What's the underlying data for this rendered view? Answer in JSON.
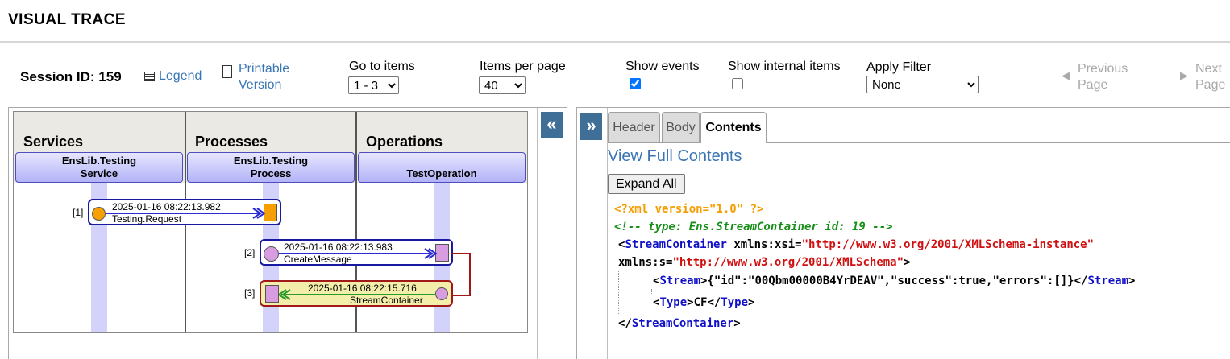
{
  "header": {
    "title": "VISUAL TRACE"
  },
  "toolbar": {
    "session_label": "Session ID: 159",
    "legend_label": "Legend",
    "printable_line1": "Printable",
    "printable_line2": "Version",
    "goto_label": "Go to items",
    "goto_value": "1 - 3",
    "per_page_label": "Items per page",
    "per_page_value": "40",
    "show_events_label": "Show events",
    "show_events_checked": true,
    "show_internal_label": "Show internal items",
    "show_internal_checked": false,
    "filter_label": "Apply Filter",
    "filter_value": "None",
    "prev_line1": "Previous",
    "prev_line2": "Page",
    "next_line1": "Next",
    "next_line2": "Page"
  },
  "trace": {
    "collapse_glyph": "«",
    "expand_glyph": "»",
    "columns": [
      {
        "header": "Services",
        "box_line1": "EnsLib.Testing",
        "box_line2": "Service"
      },
      {
        "header": "Processes",
        "box_line1": "EnsLib.Testing",
        "box_line2": "Process"
      },
      {
        "header": "Operations",
        "box_line1": "",
        "box_line2": "TestOperation"
      }
    ],
    "messages": [
      {
        "seq": "[1]",
        "time": "2025-01-16 08:22:13.982",
        "name": "Testing.Request"
      },
      {
        "seq": "[2]",
        "time": "2025-01-16 08:22:13.983",
        "name": "CreateMessage"
      },
      {
        "seq": "[3]",
        "time": "2025-01-16 08:22:15.716",
        "name": "StreamContainer"
      }
    ]
  },
  "detail": {
    "tabs": [
      "Header",
      "Body",
      "Contents"
    ],
    "active_tab": "Contents",
    "view_full_label": "View Full Contents",
    "expand_all_label": "Expand All",
    "xml": {
      "pi": "<?xml version=\"1.0\" ?>",
      "comment": "<!-- type: Ens.StreamContainer  id: 19 -->",
      "root_tag": "StreamContainer",
      "attr1_name": "xmlns:xsi",
      "attr1_value": "\"http://www.w3.org/2001/XMLSchema-instance\"",
      "attr2_name": "xmlns:s",
      "attr2_value": "\"http://www.w3.org/2001/XMLSchema\"",
      "stream_tag": "Stream",
      "stream_value": "{\"id\":\"00Qbm00000B4YrDEAV\",\"success\":true,\"errors\":[]}",
      "type_tag": "Type",
      "type_value": "CF"
    }
  }
}
